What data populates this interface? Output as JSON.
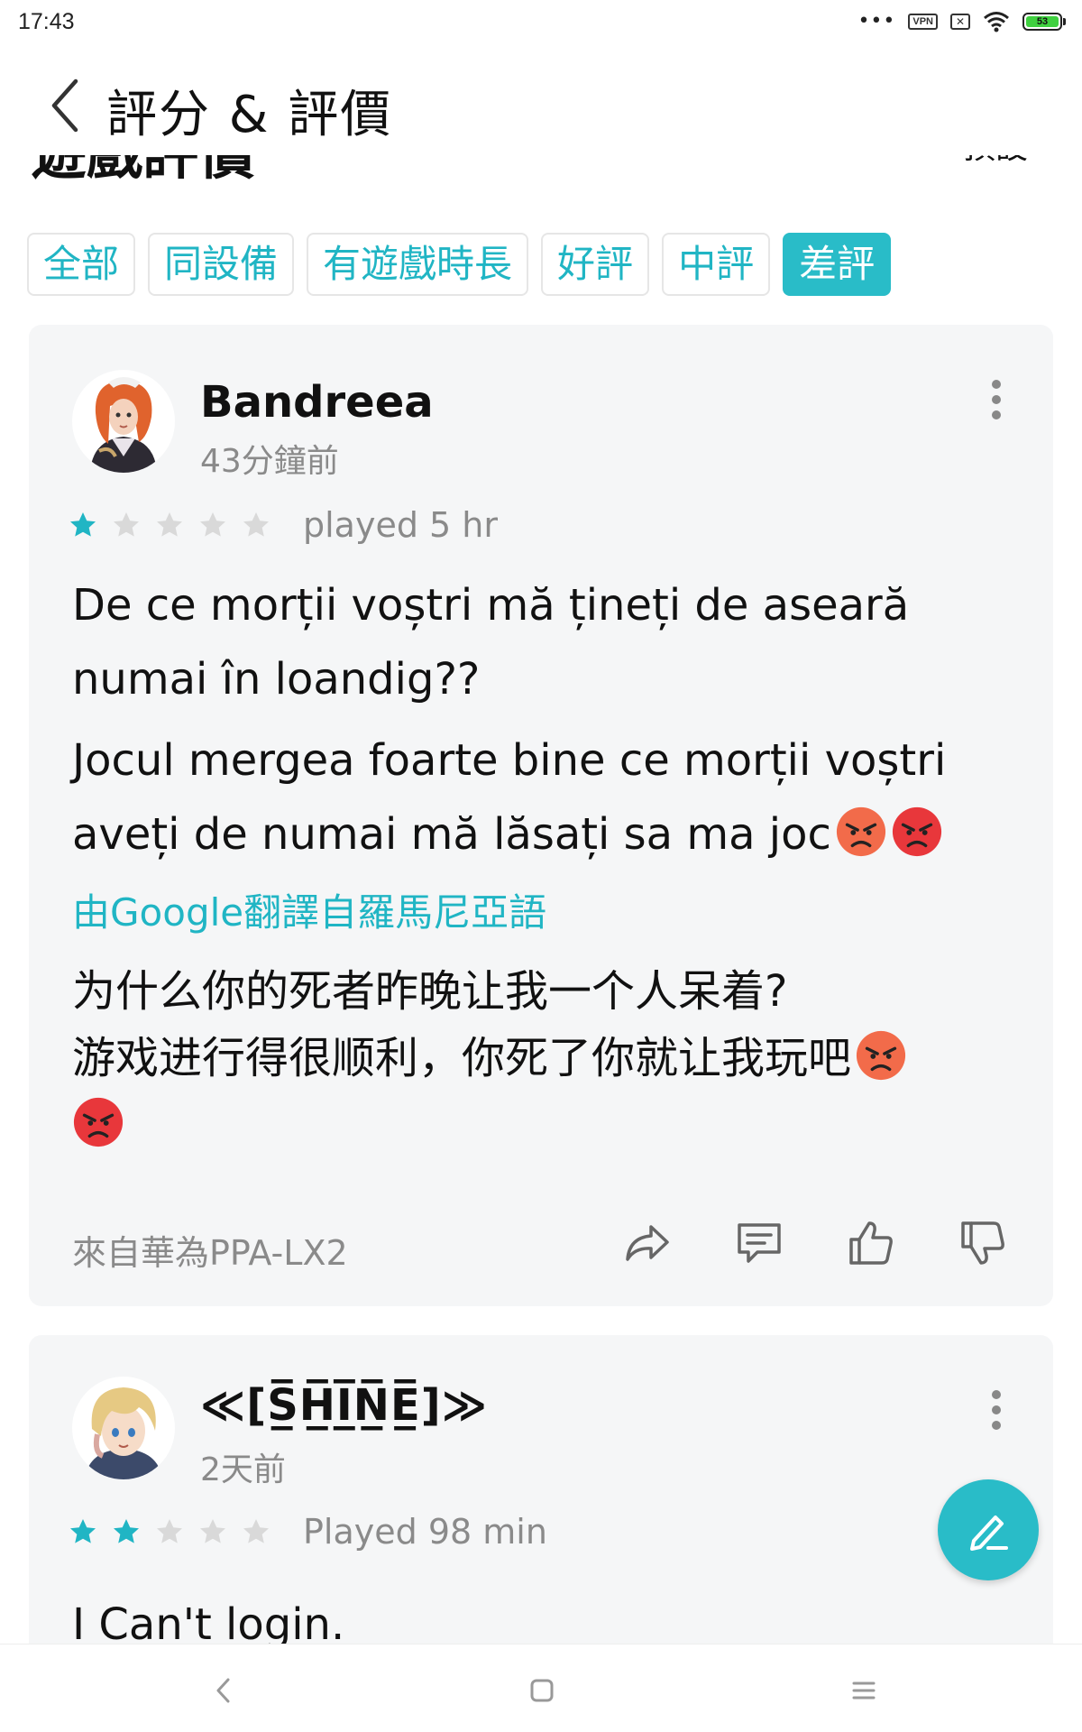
{
  "status_bar": {
    "time": "17:43",
    "vpn": "VPN",
    "battery": "53"
  },
  "header": {
    "title": "評分 & 評價",
    "section_title": "遊戲評價",
    "section_more": "預設"
  },
  "filters": [
    {
      "label": "全部",
      "active": false
    },
    {
      "label": "同設備",
      "active": false
    },
    {
      "label": "有遊戲時長",
      "active": false
    },
    {
      "label": "好評",
      "active": false
    },
    {
      "label": "中評",
      "active": false
    },
    {
      "label": "差評",
      "active": true
    }
  ],
  "reviews": [
    {
      "username": "Bandreea",
      "time_ago": "43分鐘前",
      "rating": 1,
      "max_rating": 5,
      "played": "played 5 hr",
      "paragraphs": [
        "De ce morții voștri mă țineți de aseară numai în loandig??",
        "Jocul mergea foarte bine ce morții voștri aveți de numai mă lăsați sa ma joc"
      ],
      "translation_note": "由Google翻譯自羅馬尼亞語",
      "translated_lines": [
        "为什么你的死者昨晚让我一个人呆着?",
        "游戏进行得很顺利，你死了你就让我玩吧"
      ],
      "device": "來自華為PPA-LX2"
    },
    {
      "username": "≪[S̲̅H̲̅I̲̅N̲̅E̲̅]≫",
      "time_ago": "2天前",
      "rating": 2,
      "max_rating": 5,
      "played": "Played 98 min",
      "paragraphs": [
        "I Can't login."
      ]
    }
  ],
  "colors": {
    "accent": "#29bcc8",
    "star_on": "#20b5c4",
    "star_off": "#d9d9d9",
    "card_bg": "#f5f6f7"
  },
  "icons": [
    "back-icon",
    "more-icon",
    "share-icon",
    "comment-icon",
    "thumbs-up-icon",
    "thumbs-down-icon",
    "edit-icon",
    "angry-emoji"
  ]
}
